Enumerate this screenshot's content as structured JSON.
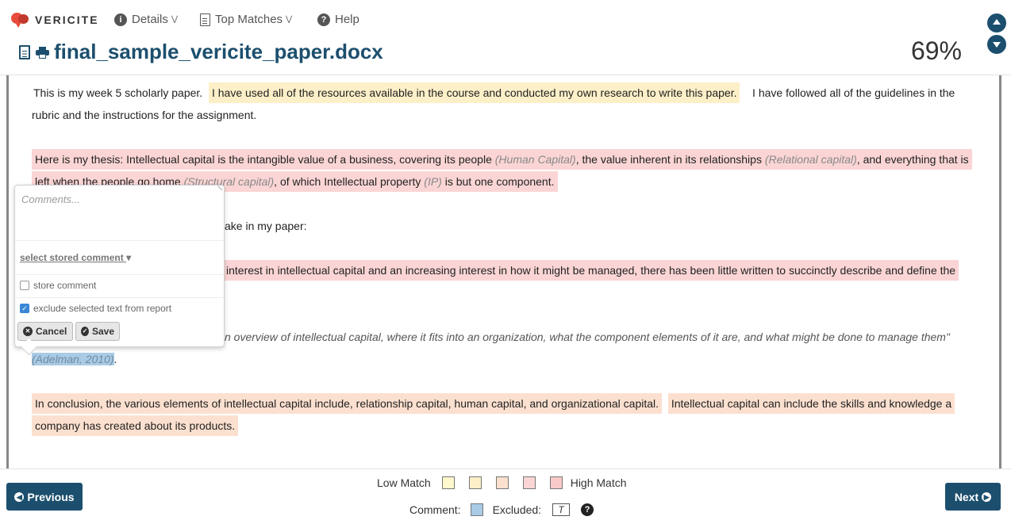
{
  "app": {
    "brand": "VERICITE"
  },
  "nav": {
    "details": "Details",
    "top_matches": "Top Matches",
    "help": "Help"
  },
  "doc": {
    "filename": "final_sample_vericite_paper.docx",
    "score": "69%"
  },
  "paragraphs": {
    "p1_a": "This is my week 5 scholarly paper.",
    "p1_b": "I have used all of the resources available in the course and conducted my own research to write this paper.",
    "p1_c": "I have followed all of the guidelines in the",
    "p1_d": "rubric and the instructions for the assignment.",
    "p2_a": "Here is my thesis: Intellectual capital is the intangible value of a business, covering its people ",
    "p2_b": "(Human Capital)",
    "p2_c": ", the value inherent in its relationships ",
    "p2_d": "(Relational capital)",
    "p2_e": ", and everything that is",
    "p2_f": "left when the people go home ",
    "p2_g": "(Structural capital)",
    "p2_h": ", of which Intellectual property ",
    "p2_i": "(IP)",
    "p2_j": " is but one component.",
    "p3": "ake in my paper:",
    "p4_a": "interest in intellectual capital and an increasing interest in how it might be managed, there has been little written to succinctly describe and define the",
    "p5_a": "n overview of intellectual capital, where it fits into an organization, what the component elements of it are, and what might be done to manage them\"",
    "p5_b": "(Adelman, 2010)",
    "p5_c": ".",
    "p6_a": "In conclusion, the various elements of intellectual capital include, relationship capital, human capital, and organizational capital.",
    "p6_b": "Intellectual capital can include the skills and knowledge a",
    "p6_c": "company has created about its products."
  },
  "popup": {
    "comments_placeholder": "Comments...",
    "select_stored": "select stored comment",
    "store_comment": "store comment",
    "store_comment_checked": false,
    "exclude_text": "exclude selected text from report",
    "exclude_checked": true,
    "cancel": "Cancel",
    "save": "Save"
  },
  "footer": {
    "previous": "Previous",
    "next": "Next",
    "low_match": "Low Match",
    "high_match": "High Match",
    "comment": "Comment:",
    "excluded": "Excluded:",
    "excluded_symbol": "T",
    "match_colors": [
      "#fff8cc",
      "#fdf0c8",
      "#fce0cf",
      "#fbd5d5",
      "#f9c8c8"
    ],
    "comment_color": "#a9cbe5"
  }
}
